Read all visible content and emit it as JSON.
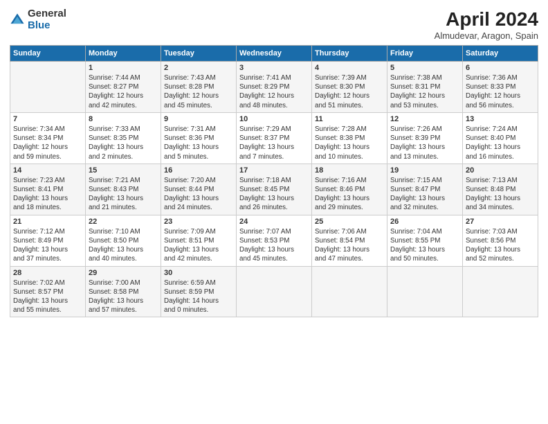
{
  "logo": {
    "general": "General",
    "blue": "Blue"
  },
  "title": "April 2024",
  "subtitle": "Almudevar, Aragon, Spain",
  "columns": [
    "Sunday",
    "Monday",
    "Tuesday",
    "Wednesday",
    "Thursday",
    "Friday",
    "Saturday"
  ],
  "weeks": [
    [
      {
        "day": "",
        "info": ""
      },
      {
        "day": "1",
        "info": "Sunrise: 7:44 AM\nSunset: 8:27 PM\nDaylight: 12 hours\nand 42 minutes."
      },
      {
        "day": "2",
        "info": "Sunrise: 7:43 AM\nSunset: 8:28 PM\nDaylight: 12 hours\nand 45 minutes."
      },
      {
        "day": "3",
        "info": "Sunrise: 7:41 AM\nSunset: 8:29 PM\nDaylight: 12 hours\nand 48 minutes."
      },
      {
        "day": "4",
        "info": "Sunrise: 7:39 AM\nSunset: 8:30 PM\nDaylight: 12 hours\nand 51 minutes."
      },
      {
        "day": "5",
        "info": "Sunrise: 7:38 AM\nSunset: 8:31 PM\nDaylight: 12 hours\nand 53 minutes."
      },
      {
        "day": "6",
        "info": "Sunrise: 7:36 AM\nSunset: 8:33 PM\nDaylight: 12 hours\nand 56 minutes."
      }
    ],
    [
      {
        "day": "7",
        "info": "Sunrise: 7:34 AM\nSunset: 8:34 PM\nDaylight: 12 hours\nand 59 minutes."
      },
      {
        "day": "8",
        "info": "Sunrise: 7:33 AM\nSunset: 8:35 PM\nDaylight: 13 hours\nand 2 minutes."
      },
      {
        "day": "9",
        "info": "Sunrise: 7:31 AM\nSunset: 8:36 PM\nDaylight: 13 hours\nand 5 minutes."
      },
      {
        "day": "10",
        "info": "Sunrise: 7:29 AM\nSunset: 8:37 PM\nDaylight: 13 hours\nand 7 minutes."
      },
      {
        "day": "11",
        "info": "Sunrise: 7:28 AM\nSunset: 8:38 PM\nDaylight: 13 hours\nand 10 minutes."
      },
      {
        "day": "12",
        "info": "Sunrise: 7:26 AM\nSunset: 8:39 PM\nDaylight: 13 hours\nand 13 minutes."
      },
      {
        "day": "13",
        "info": "Sunrise: 7:24 AM\nSunset: 8:40 PM\nDaylight: 13 hours\nand 16 minutes."
      }
    ],
    [
      {
        "day": "14",
        "info": "Sunrise: 7:23 AM\nSunset: 8:41 PM\nDaylight: 13 hours\nand 18 minutes."
      },
      {
        "day": "15",
        "info": "Sunrise: 7:21 AM\nSunset: 8:43 PM\nDaylight: 13 hours\nand 21 minutes."
      },
      {
        "day": "16",
        "info": "Sunrise: 7:20 AM\nSunset: 8:44 PM\nDaylight: 13 hours\nand 24 minutes."
      },
      {
        "day": "17",
        "info": "Sunrise: 7:18 AM\nSunset: 8:45 PM\nDaylight: 13 hours\nand 26 minutes."
      },
      {
        "day": "18",
        "info": "Sunrise: 7:16 AM\nSunset: 8:46 PM\nDaylight: 13 hours\nand 29 minutes."
      },
      {
        "day": "19",
        "info": "Sunrise: 7:15 AM\nSunset: 8:47 PM\nDaylight: 13 hours\nand 32 minutes."
      },
      {
        "day": "20",
        "info": "Sunrise: 7:13 AM\nSunset: 8:48 PM\nDaylight: 13 hours\nand 34 minutes."
      }
    ],
    [
      {
        "day": "21",
        "info": "Sunrise: 7:12 AM\nSunset: 8:49 PM\nDaylight: 13 hours\nand 37 minutes."
      },
      {
        "day": "22",
        "info": "Sunrise: 7:10 AM\nSunset: 8:50 PM\nDaylight: 13 hours\nand 40 minutes."
      },
      {
        "day": "23",
        "info": "Sunrise: 7:09 AM\nSunset: 8:51 PM\nDaylight: 13 hours\nand 42 minutes."
      },
      {
        "day": "24",
        "info": "Sunrise: 7:07 AM\nSunset: 8:53 PM\nDaylight: 13 hours\nand 45 minutes."
      },
      {
        "day": "25",
        "info": "Sunrise: 7:06 AM\nSunset: 8:54 PM\nDaylight: 13 hours\nand 47 minutes."
      },
      {
        "day": "26",
        "info": "Sunrise: 7:04 AM\nSunset: 8:55 PM\nDaylight: 13 hours\nand 50 minutes."
      },
      {
        "day": "27",
        "info": "Sunrise: 7:03 AM\nSunset: 8:56 PM\nDaylight: 13 hours\nand 52 minutes."
      }
    ],
    [
      {
        "day": "28",
        "info": "Sunrise: 7:02 AM\nSunset: 8:57 PM\nDaylight: 13 hours\nand 55 minutes."
      },
      {
        "day": "29",
        "info": "Sunrise: 7:00 AM\nSunset: 8:58 PM\nDaylight: 13 hours\nand 57 minutes."
      },
      {
        "day": "30",
        "info": "Sunrise: 6:59 AM\nSunset: 8:59 PM\nDaylight: 14 hours\nand 0 minutes."
      },
      {
        "day": "",
        "info": ""
      },
      {
        "day": "",
        "info": ""
      },
      {
        "day": "",
        "info": ""
      },
      {
        "day": "",
        "info": ""
      }
    ]
  ]
}
